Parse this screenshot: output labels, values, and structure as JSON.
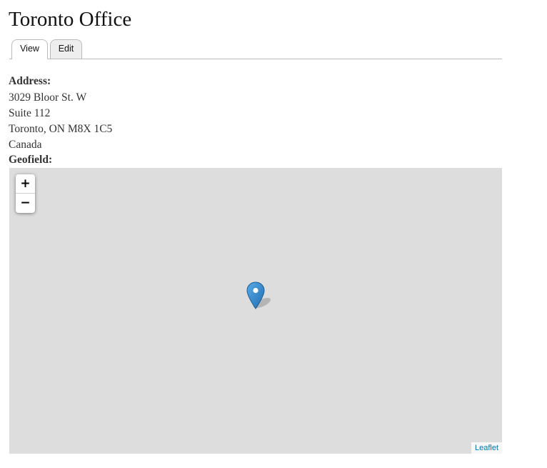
{
  "page": {
    "title": "Toronto Office"
  },
  "tabs": [
    {
      "label": "View",
      "active": true
    },
    {
      "label": "Edit",
      "active": false
    }
  ],
  "address": {
    "label": "Address:",
    "lines": [
      "3029 Bloor St. W",
      "Suite 112",
      "Toronto, ON M8X 1C5",
      "Canada"
    ]
  },
  "geofield": {
    "label": "Geofield:",
    "map": {
      "zoom_in_label": "+",
      "zoom_out_label": "−",
      "attribution": "Leaflet",
      "marker_icon": "map-marker-icon",
      "background_color": "#dddddd",
      "marker_color": "#2e85cb"
    }
  }
}
